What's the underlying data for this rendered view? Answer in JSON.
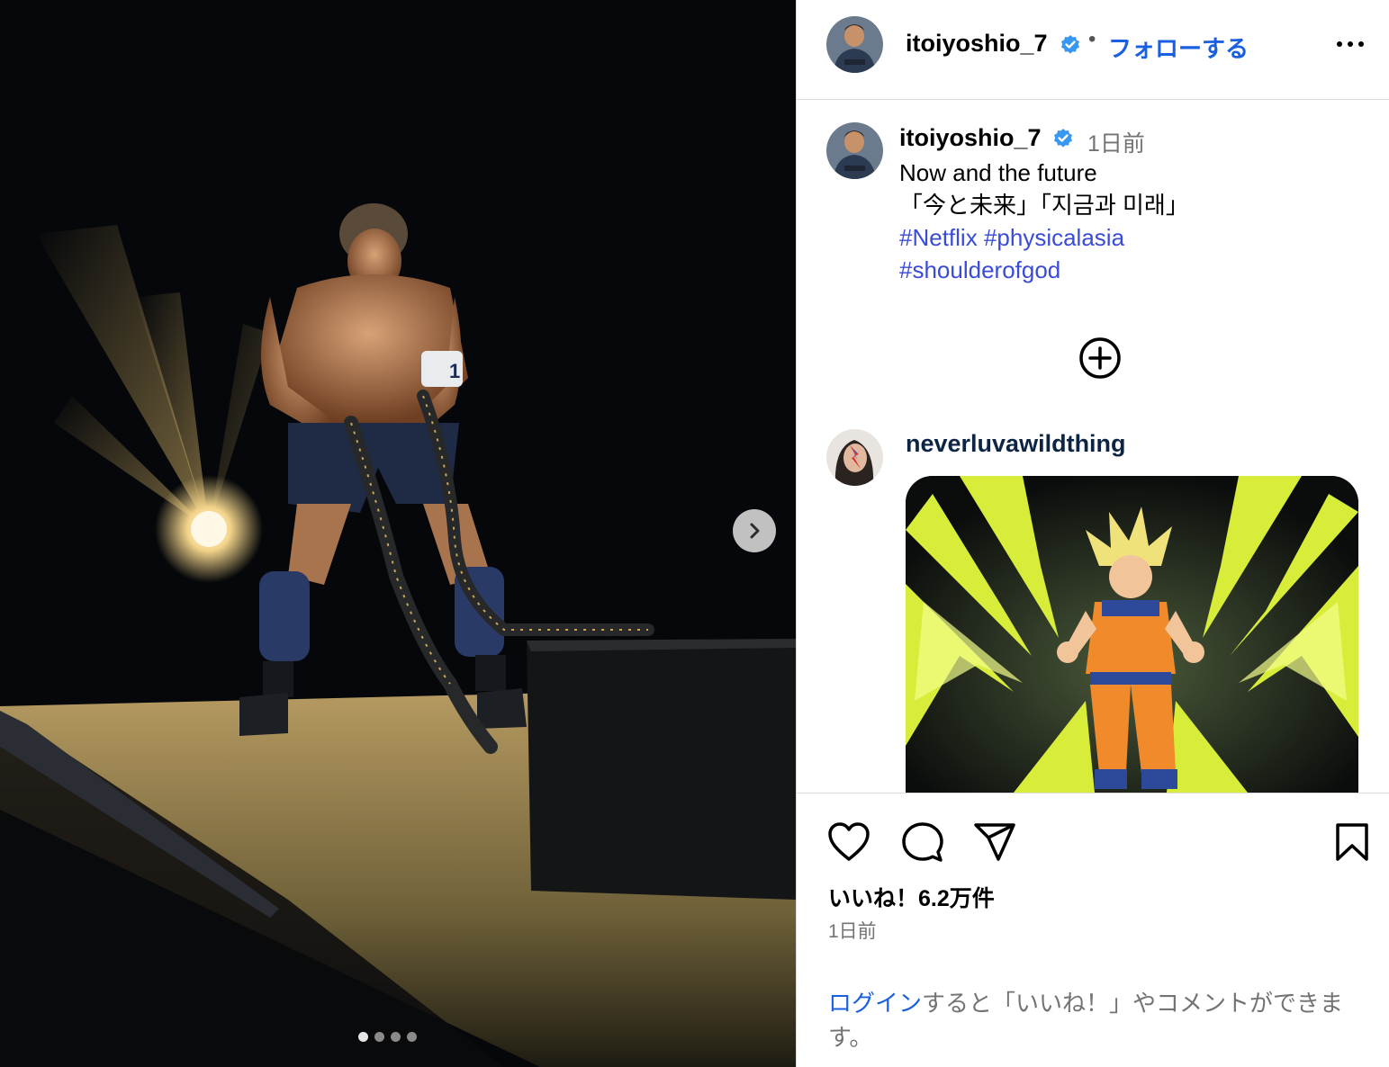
{
  "header": {
    "username": "itoiyoshio_7",
    "separator": "•",
    "follow_label": "フォローする"
  },
  "caption": {
    "username": "itoiyoshio_7",
    "time": "1日前",
    "line1": "Now and the future",
    "line2": "「今と未来」「지금과 미래」",
    "hashtags": [
      "#Netflix",
      "#physicalasia",
      "#shoulderofgod"
    ]
  },
  "comment": {
    "username": "neverluvawildthing"
  },
  "media": {
    "carousel_count": 4,
    "active_index": 0,
    "armband_number": "1"
  },
  "footer": {
    "likes": "いいね！6.2万件",
    "time": "1日前",
    "login_link": "ログイン",
    "login_rest": "すると「いいね！」やコメントができます。"
  },
  "colors": {
    "link_blue": "#1a5fe0",
    "hashtag": "#3a4bd8",
    "verified": "#3897f0",
    "muted": "#737373"
  },
  "icons": [
    "chevron-right-icon",
    "verified-icon",
    "more-icon",
    "plus-circle-icon",
    "heart-icon",
    "comment-icon",
    "share-icon",
    "bookmark-icon"
  ]
}
